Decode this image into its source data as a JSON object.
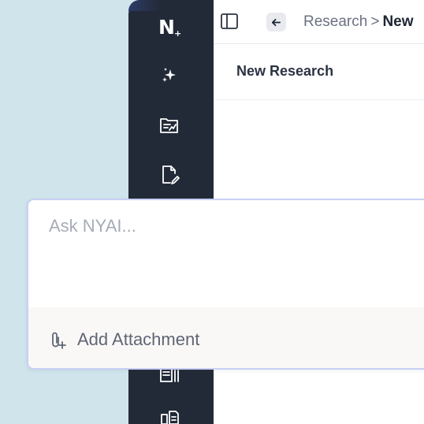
{
  "sidebar": {
    "logo_text": "N",
    "logo_plus": "+",
    "icons": [
      "sparkle-icon",
      "folder-chart-icon",
      "document-edit-icon",
      "document-list-icon",
      "document-compare-icon"
    ]
  },
  "header": {
    "breadcrumb_parent": "Research",
    "breadcrumb_separator": ">",
    "breadcrumb_current": "New"
  },
  "main": {
    "title": "New Research"
  },
  "ask": {
    "placeholder": "Ask NYAI...",
    "attach_label": "Add Attachment"
  },
  "colors": {
    "sidebar_bg": "#232a37",
    "desktop_bg": "#cfe4eb",
    "ask_border": "#c9d0f5"
  }
}
